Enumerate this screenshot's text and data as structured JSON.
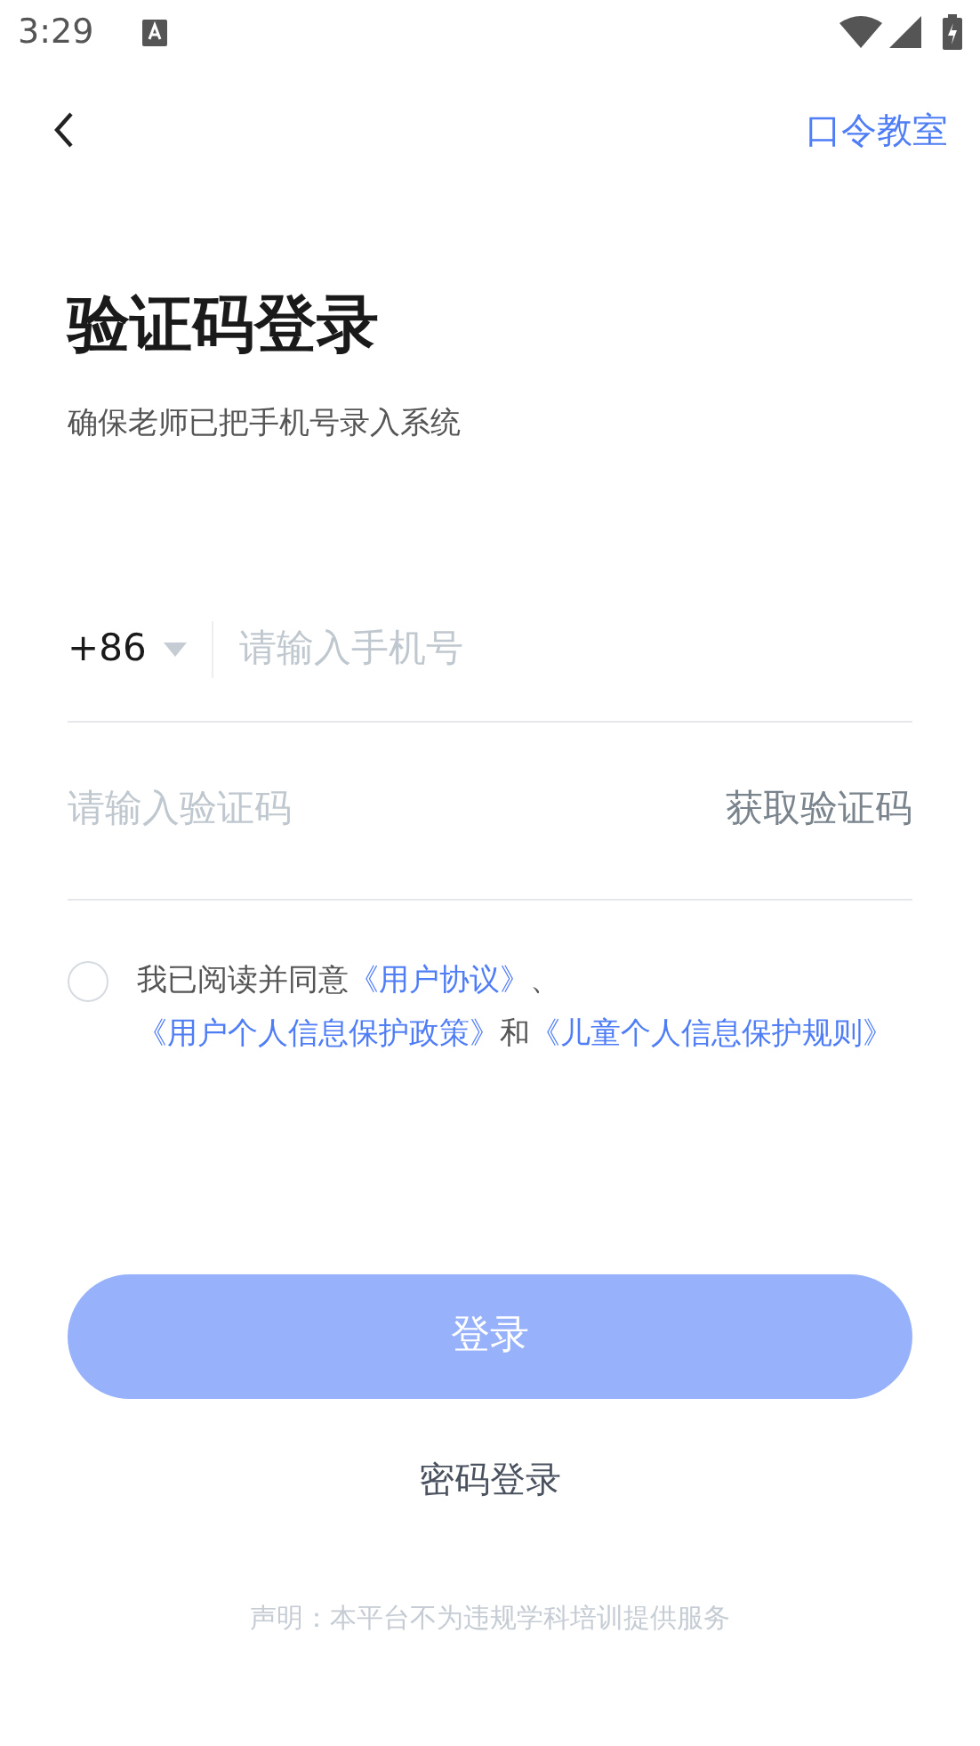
{
  "status_bar": {
    "time": "3:29"
  },
  "header": {
    "action": "口令教室"
  },
  "title": "验证码登录",
  "subtitle": "确保老师已把手机号录入系统",
  "phone": {
    "country_code": "+86",
    "placeholder": "请输入手机号"
  },
  "code": {
    "placeholder": "请输入验证码",
    "action": "获取验证码"
  },
  "agreement": {
    "checked": false,
    "parts": [
      {
        "kind": "text",
        "text": "我已阅读并同意"
      },
      {
        "kind": "link",
        "text": "《用户协议》"
      },
      {
        "kind": "text",
        "text": "、"
      },
      {
        "kind": "link",
        "text": "《用户个人信息保护政策》"
      },
      {
        "kind": "text",
        "text": "和"
      },
      {
        "kind": "link",
        "text": "《儿童个人信息保护规则》"
      }
    ]
  },
  "login_button": {
    "label": "登录",
    "disabled": true
  },
  "alt_login": "密码登录",
  "disclaimer": "声明：本平台不为违规学科培训提供服务"
}
